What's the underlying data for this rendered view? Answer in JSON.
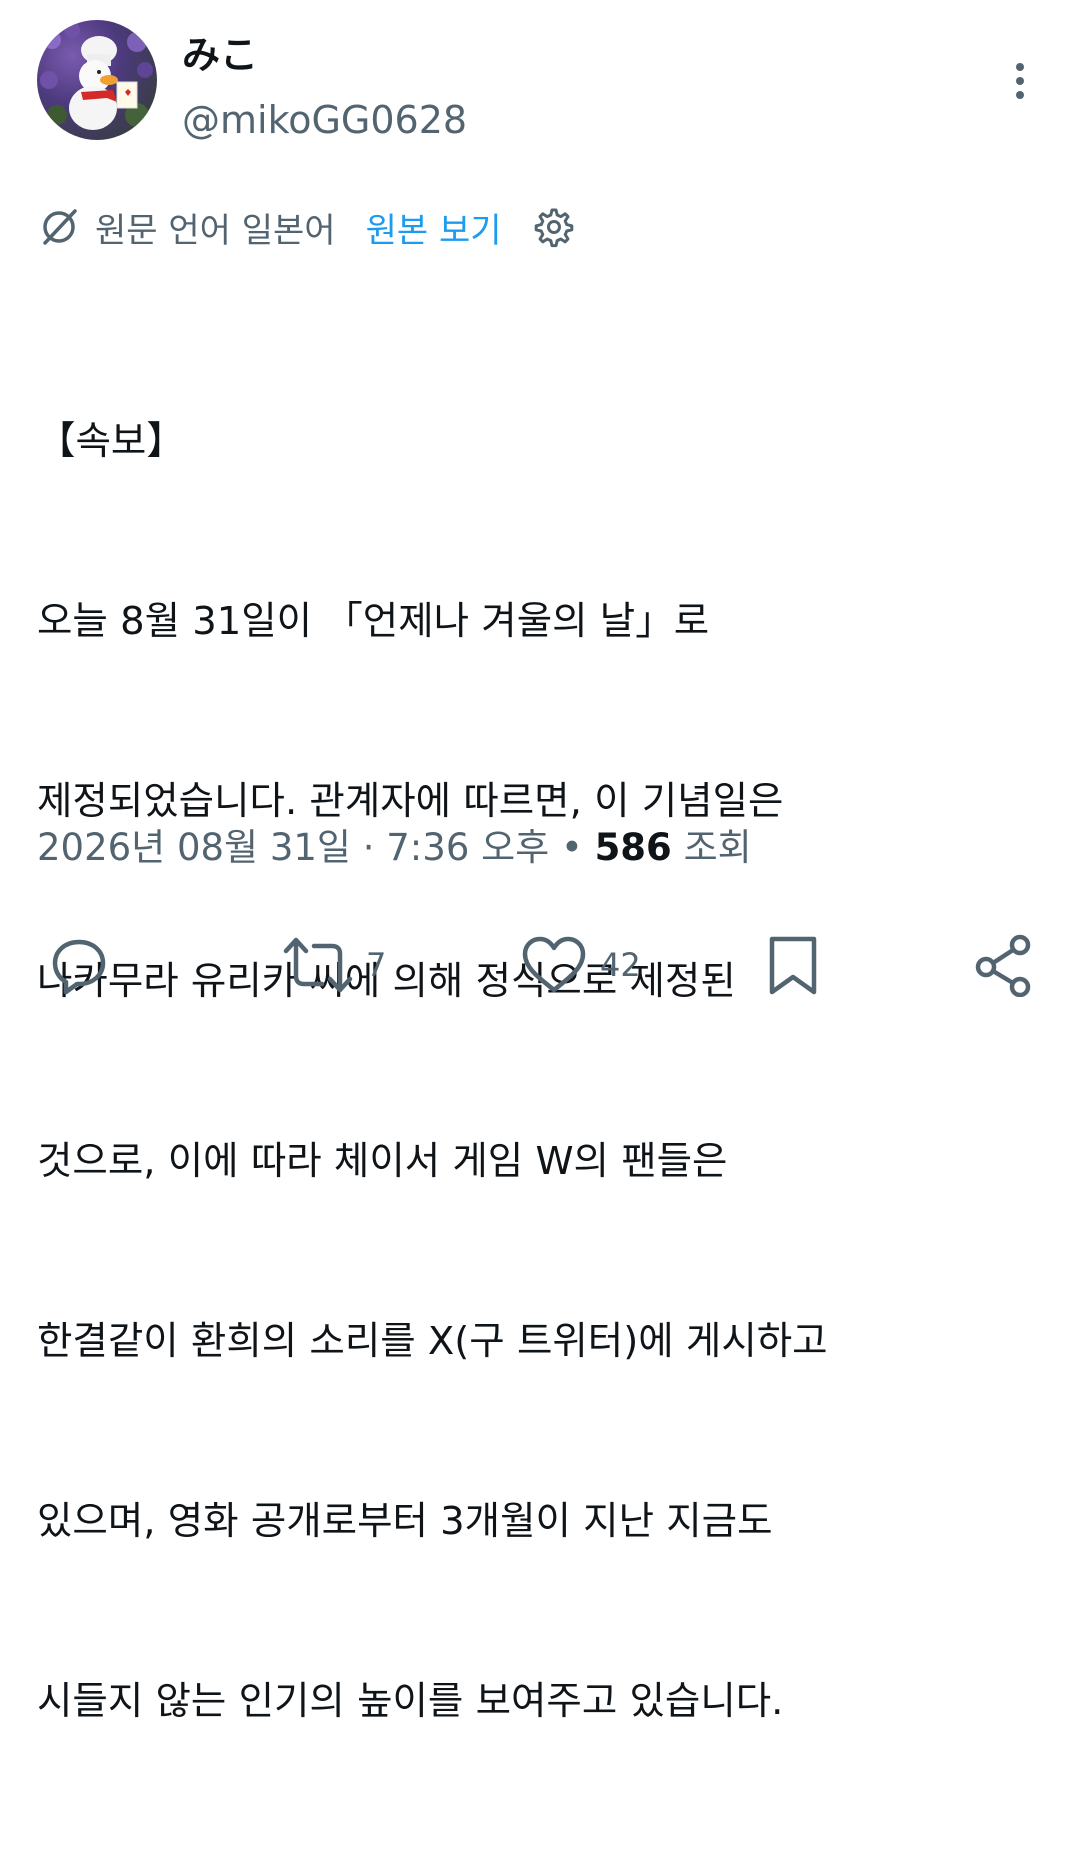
{
  "author": {
    "display_name": "みこ",
    "handle": "@mikoGG0628"
  },
  "translation": {
    "label": "원문 언어 일본어",
    "link": "원본 보기"
  },
  "tweet": {
    "lines": [
      "【속보】",
      "오늘 8월 31일이 「언제나 겨울의 날」로",
      "제정되었습니다. 관계자에 따르면, 이 기념일은",
      "나카무라 유리카 씨에 의해 정식으로 제정된",
      "것으로, 이에 따라 체이서 게임 W의 팬들은",
      "한결같이 환희의 소리를 X(구 트위터)에 게시하고",
      "있으며, 영화 공개로부터 3개월이 지난 지금도",
      "시들지 않는 인기의 높이를 보여주고 있습니다."
    ]
  },
  "meta": {
    "date": "2026년 08월 31일",
    "time": "7:36 오후",
    "views_count": "586",
    "views_label": "조회"
  },
  "actions": {
    "reply_icon": "reply-icon",
    "retweet_count": "7",
    "like_count": "42",
    "bookmark_icon": "bookmark-icon",
    "share_icon": "share-icon"
  },
  "colors": {
    "text": "#0f1419",
    "secondary": "#536471",
    "link": "#1d9bf0"
  }
}
